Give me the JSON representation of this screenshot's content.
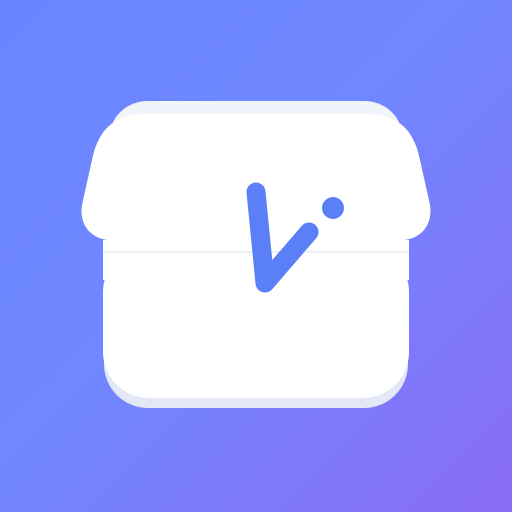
{
  "app_icon": {
    "icon_name": "checkmark-box-icon",
    "colors": {
      "background_start": "#6a86ff",
      "background_end": "#8a6cf6",
      "box": "#ffffff",
      "box_shadow": "#e6e9f7",
      "accent": "#5b7ff6"
    }
  }
}
